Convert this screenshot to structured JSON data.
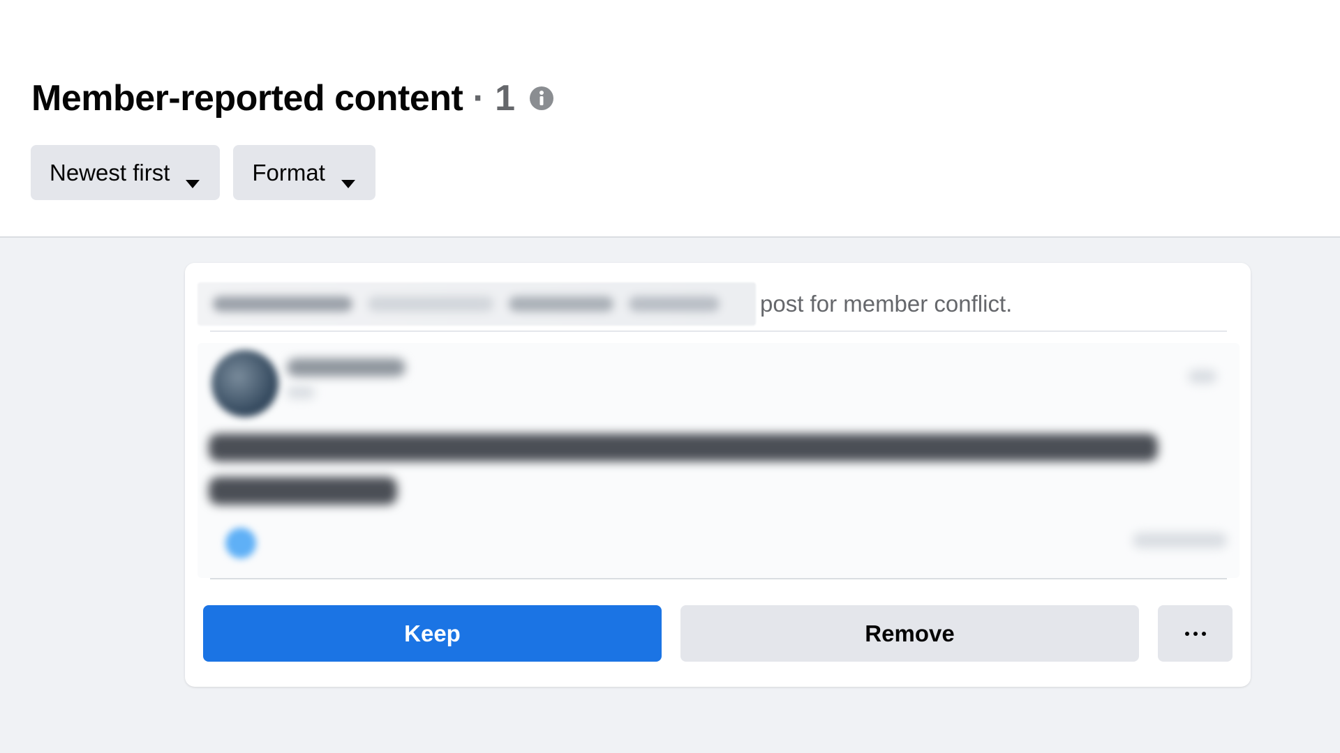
{
  "header": {
    "title": "Member-reported content",
    "count": "· 1",
    "info_icon": "info-icon"
  },
  "filters": [
    {
      "label": "Newest first",
      "icon": "caret-down-icon"
    },
    {
      "label": "Format",
      "icon": "caret-down-icon"
    }
  ],
  "report": {
    "reason_text": "post for member conflict."
  },
  "actions": {
    "keep_label": "Keep",
    "remove_label": "Remove",
    "more_icon": "more-options-icon"
  },
  "colors": {
    "primary": "#1b74e4",
    "secondary_button": "#e4e6eb",
    "page_background": "#f0f2f5",
    "secondary_text": "#65676b"
  }
}
